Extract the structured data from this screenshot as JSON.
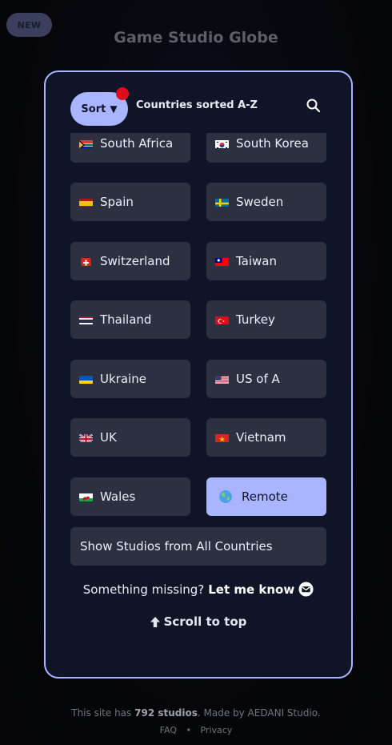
{
  "badge": "NEW",
  "site_title": "Game Studio Globe",
  "toolbar": {
    "sort_label": "Sort",
    "sort_arrow": "▼",
    "caption": "Countries sorted A-Z",
    "search_icon": "search-icon"
  },
  "countries": [
    {
      "label": "South Africa",
      "flag": "za"
    },
    {
      "label": "South Korea",
      "flag": "kr"
    },
    {
      "label": "Spain",
      "flag": "es"
    },
    {
      "label": "Sweden",
      "flag": "se"
    },
    {
      "label": "Switzerland",
      "flag": "ch"
    },
    {
      "label": "Taiwan",
      "flag": "tw"
    },
    {
      "label": "Thailand",
      "flag": "th"
    },
    {
      "label": "Turkey",
      "flag": "tr"
    },
    {
      "label": "Ukraine",
      "flag": "ua"
    },
    {
      "label": "US of A",
      "flag": "us"
    },
    {
      "label": "UK",
      "flag": "gb"
    },
    {
      "label": "Vietnam",
      "flag": "vn"
    },
    {
      "label": "Wales",
      "flag": "wales"
    },
    {
      "label": "Remote",
      "flag": "globe",
      "selected": true
    }
  ],
  "all_countries_label": "Show Studios from All Countries",
  "feedback": {
    "text": "Something missing?",
    "link": "Let me know"
  },
  "scroll_top": "Scroll to top",
  "footer": {
    "prefix": "This site has",
    "count": "792 studios",
    "suffix": ". Made by AEDANI Studio.",
    "links": [
      "FAQ",
      "Privacy"
    ],
    "separator": "•"
  },
  "colors": {
    "accent": "#aab5ff",
    "panel": "#101427",
    "button": "#2d3040",
    "notification": "#e00c1c"
  }
}
